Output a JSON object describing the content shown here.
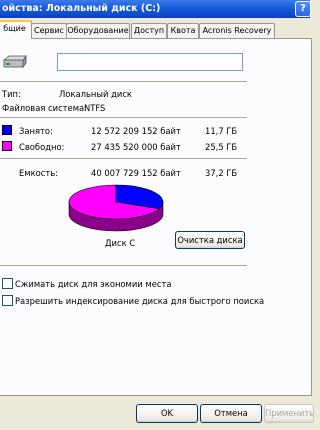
{
  "window": {
    "title": "ойства: Локальный диск (C:)",
    "help_label": "?"
  },
  "tabs": [
    {
      "label": "бщие",
      "active": true
    },
    {
      "label": "Сервис",
      "active": false
    },
    {
      "label": "Оборудование",
      "active": false
    },
    {
      "label": "Доступ",
      "active": false
    },
    {
      "label": "Квота",
      "active": false
    },
    {
      "label": "Acronis Recovery",
      "active": false
    }
  ],
  "general": {
    "volume_label_value": "",
    "type_label": "Тип:",
    "type_value": "Локальный диск",
    "fs_label": "Файловая система:",
    "fs_value": "NTFS",
    "used_label": "Занято:",
    "used_bytes": "12 572 209 152 байт",
    "used_gb": "11,7 ГБ",
    "free_label": "Свободно:",
    "free_bytes": "27 435 520 000 байт",
    "free_gb": "25,5 ГБ",
    "capacity_label": "Емкость:",
    "capacity_bytes": "40 007 729 152 байт",
    "capacity_gb": "37,2 ГБ",
    "disk_label": "Диск C",
    "cleanup_button": "Очистка диска",
    "used_fraction": 0.314,
    "used_color": "#0000ff",
    "free_color": "#ff00ff"
  },
  "options": {
    "compress_label": "Сжимать диск для экономии места",
    "compress_checked": false,
    "index_label": "Разрешить индексирование диска для быстрого поиска",
    "index_checked": false
  },
  "buttons": {
    "ok": "OK",
    "cancel": "Отмена",
    "apply": "Применить"
  }
}
